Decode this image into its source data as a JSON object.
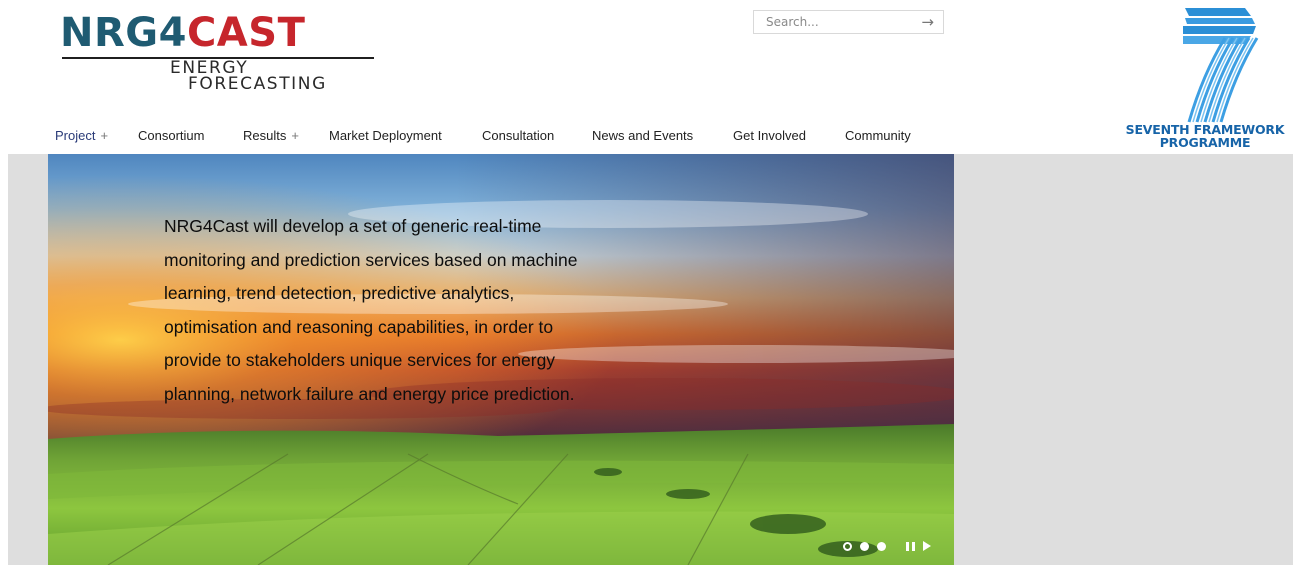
{
  "logo": {
    "main_part1": "NRG4",
    "main_part2": "CAST",
    "sub_line1": "ENERGY",
    "sub_line2": "FORECASTING"
  },
  "search": {
    "placeholder": "Search...",
    "submit_icon": "arrow-right-icon"
  },
  "fp7": {
    "line1": "SEVENTH FRAMEWORK",
    "line2": "PROGRAMME",
    "icon": "fp7-logo-icon"
  },
  "nav": {
    "items": [
      {
        "label": "Project",
        "plus": "+"
      },
      {
        "label": "Consortium"
      },
      {
        "label": "Results",
        "plus": "+"
      },
      {
        "label": "Market Deployment"
      },
      {
        "label": "Consultation"
      },
      {
        "label": "News and Events"
      },
      {
        "label": "Get Involved"
      },
      {
        "label": "Community"
      }
    ]
  },
  "slider": {
    "text_lines": [
      "NRG4Cast will develop a set of generic real-time",
      "monitoring and prediction services based on machine",
      "learning, trend detection, predictive analytics,",
      "optimisation and reasoning capabilities, in order to",
      "provide to stakeholders unique services for energy",
      "planning, network failure and energy price prediction."
    ],
    "slide_count": 3,
    "active_slide": 1,
    "controls": [
      "pause-icon",
      "play-icon"
    ]
  },
  "colors": {
    "logo_blue": "#1f5b72",
    "logo_red": "#c6262c",
    "fp7_blue": "#1764a8",
    "nav_active": "#2a3b78",
    "band_gray": "#dedede"
  }
}
